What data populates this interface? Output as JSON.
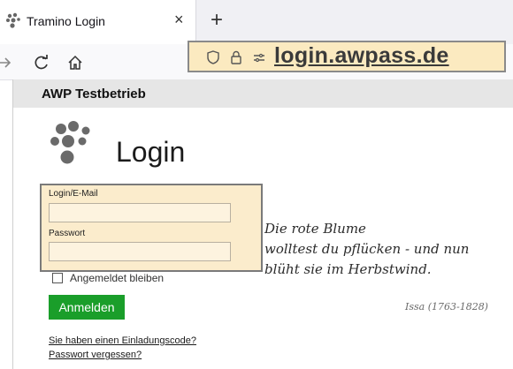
{
  "browser": {
    "tab_title": "Tramino Login",
    "tab_close": "×",
    "new_tab": "+",
    "url": "login.awpass.de"
  },
  "page": {
    "org_name": "AWP Testbetrieb",
    "title": "Login",
    "form": {
      "login_label": "Login/E-Mail",
      "login_value": "",
      "password_label": "Passwort",
      "password_value": "",
      "remember_label": "Angemeldet bleiben",
      "remember_checked": false,
      "submit_label": "Anmelden"
    },
    "links": {
      "invitation": "Sie haben einen Einladungscode?",
      "forgot_password": "Passwort vergessen?"
    },
    "poem": {
      "line1": "Die rote Blume",
      "line2": "wolltest du pflücken - und nun",
      "line3": "blüht sie im Herbstwind.",
      "author": "Issa (1763-1828)"
    },
    "colors": {
      "accent_button": "#1a9e2a",
      "highlight": "#fbeccc"
    }
  }
}
